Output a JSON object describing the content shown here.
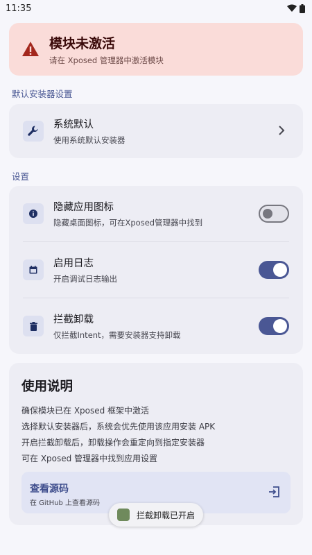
{
  "status_bar": {
    "time": "11:35"
  },
  "alert": {
    "title": "模块未激活",
    "subtitle": "请在 Xposed 管理器中激活模块",
    "color": "#fadcd9"
  },
  "installer_section": {
    "label": "默认安装器设置",
    "item": {
      "title": "系统默认",
      "subtitle": "使用系统默认安装器",
      "icon": "wrench-icon"
    }
  },
  "settings_section": {
    "label": "设置",
    "items": [
      {
        "title": "隐藏应用图标",
        "subtitle": "隐藏桌面图标，可在Xposed管理器中找到",
        "icon": "info-icon",
        "enabled": false
      },
      {
        "title": "启用日志",
        "subtitle": "开启调试日志输出",
        "icon": "calendar-icon",
        "enabled": true
      },
      {
        "title": "拦截卸载",
        "subtitle": "仅拦截Intent，需要安装器支持卸载",
        "icon": "trash-icon",
        "enabled": true
      }
    ]
  },
  "guide": {
    "title": "使用说明",
    "lines": [
      "确保模块已在 Xposed 框架中激活",
      "选择默认安装器后，系统会优先使用该应用安装 APK",
      "开启拦截卸载后，卸载操作会重定向到指定安装器",
      "可在 Xposed 管理器中找到应用设置"
    ],
    "source": {
      "title": "查看源码",
      "subtitle": "在 GitHub 上查看源码"
    }
  },
  "toast": {
    "text": "拦截卸载已开启"
  },
  "colors": {
    "accent": "#4a5794",
    "background": "#f6f6fb",
    "card": "#ededf4"
  }
}
